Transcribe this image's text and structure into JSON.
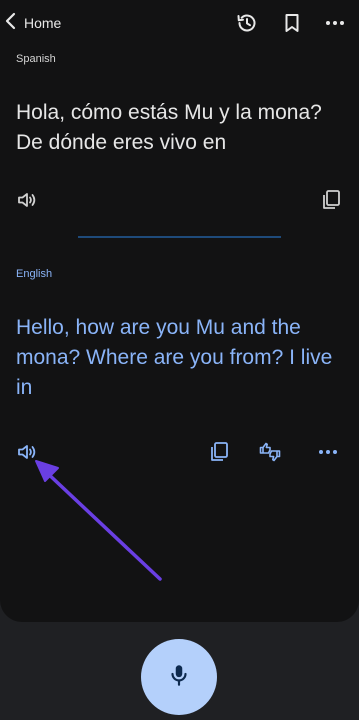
{
  "topbar": {
    "back_label": "Home"
  },
  "source": {
    "language": "Spanish",
    "text": "Hola, cómo estás Mu y la mona? De dónde eres vivo en"
  },
  "target": {
    "language": "English",
    "text": "Hello, how are you Mu and the mona? Where are you from? I live in"
  },
  "colors": {
    "background": "#1f2023",
    "card": "#121213",
    "accent_blue": "#8ab4f8",
    "mic_button": "#b4d0fb",
    "annotation_arrow": "#6a3fe3"
  },
  "icons": {
    "back": "chevron-left-icon",
    "history": "history-icon",
    "saved": "bookmark-icon",
    "menu": "more-horizontal-icon",
    "speaker": "speaker-icon",
    "copy": "copy-icon",
    "feedback": "thumbs-up-down-icon",
    "mic": "mic-icon"
  }
}
